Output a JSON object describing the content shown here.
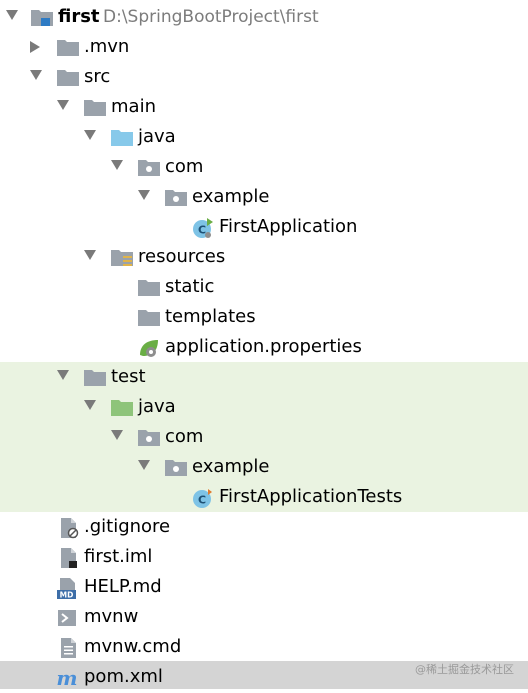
{
  "project_tree": {
    "root": {
      "name": "first",
      "path": "D:\\SpringBootProject\\first"
    },
    "mvn": {
      "name": ".mvn"
    },
    "src": {
      "name": "src"
    },
    "main": {
      "name": "main"
    },
    "main_java": {
      "name": "java"
    },
    "main_com": {
      "name": "com"
    },
    "main_example": {
      "name": "example"
    },
    "first_application": {
      "name": "FirstApplication"
    },
    "resources": {
      "name": "resources"
    },
    "static": {
      "name": "static"
    },
    "templates": {
      "name": "templates"
    },
    "application_properties": {
      "name": "application.properties"
    },
    "test": {
      "name": "test"
    },
    "test_java": {
      "name": "java"
    },
    "test_com": {
      "name": "com"
    },
    "test_example": {
      "name": "example"
    },
    "first_application_tests": {
      "name": "FirstApplicationTests"
    },
    "gitignore": {
      "name": ".gitignore"
    },
    "first_iml": {
      "name": "first.iml"
    },
    "help_md": {
      "name": "HELP.md"
    },
    "mvnw": {
      "name": "mvnw"
    },
    "mvnw_cmd": {
      "name": "mvnw.cmd"
    },
    "pom_xml": {
      "name": "pom.xml"
    }
  },
  "watermark": "@稀土掘金技术社区",
  "colors": {
    "folder": "#9aa2ab",
    "source_folder": "#87c9ea",
    "test_folder": "#8ec47a",
    "test_band": "#eaf3e1",
    "selected_row": "#d4d4d4",
    "maven_blue": "#4a8fd8",
    "spring_green": "#6aae45"
  },
  "icons": {
    "folder": "folder-icon",
    "module": "module-folder-icon",
    "package": "package-icon",
    "class": "spring-class-icon",
    "file": "file-icon"
  }
}
